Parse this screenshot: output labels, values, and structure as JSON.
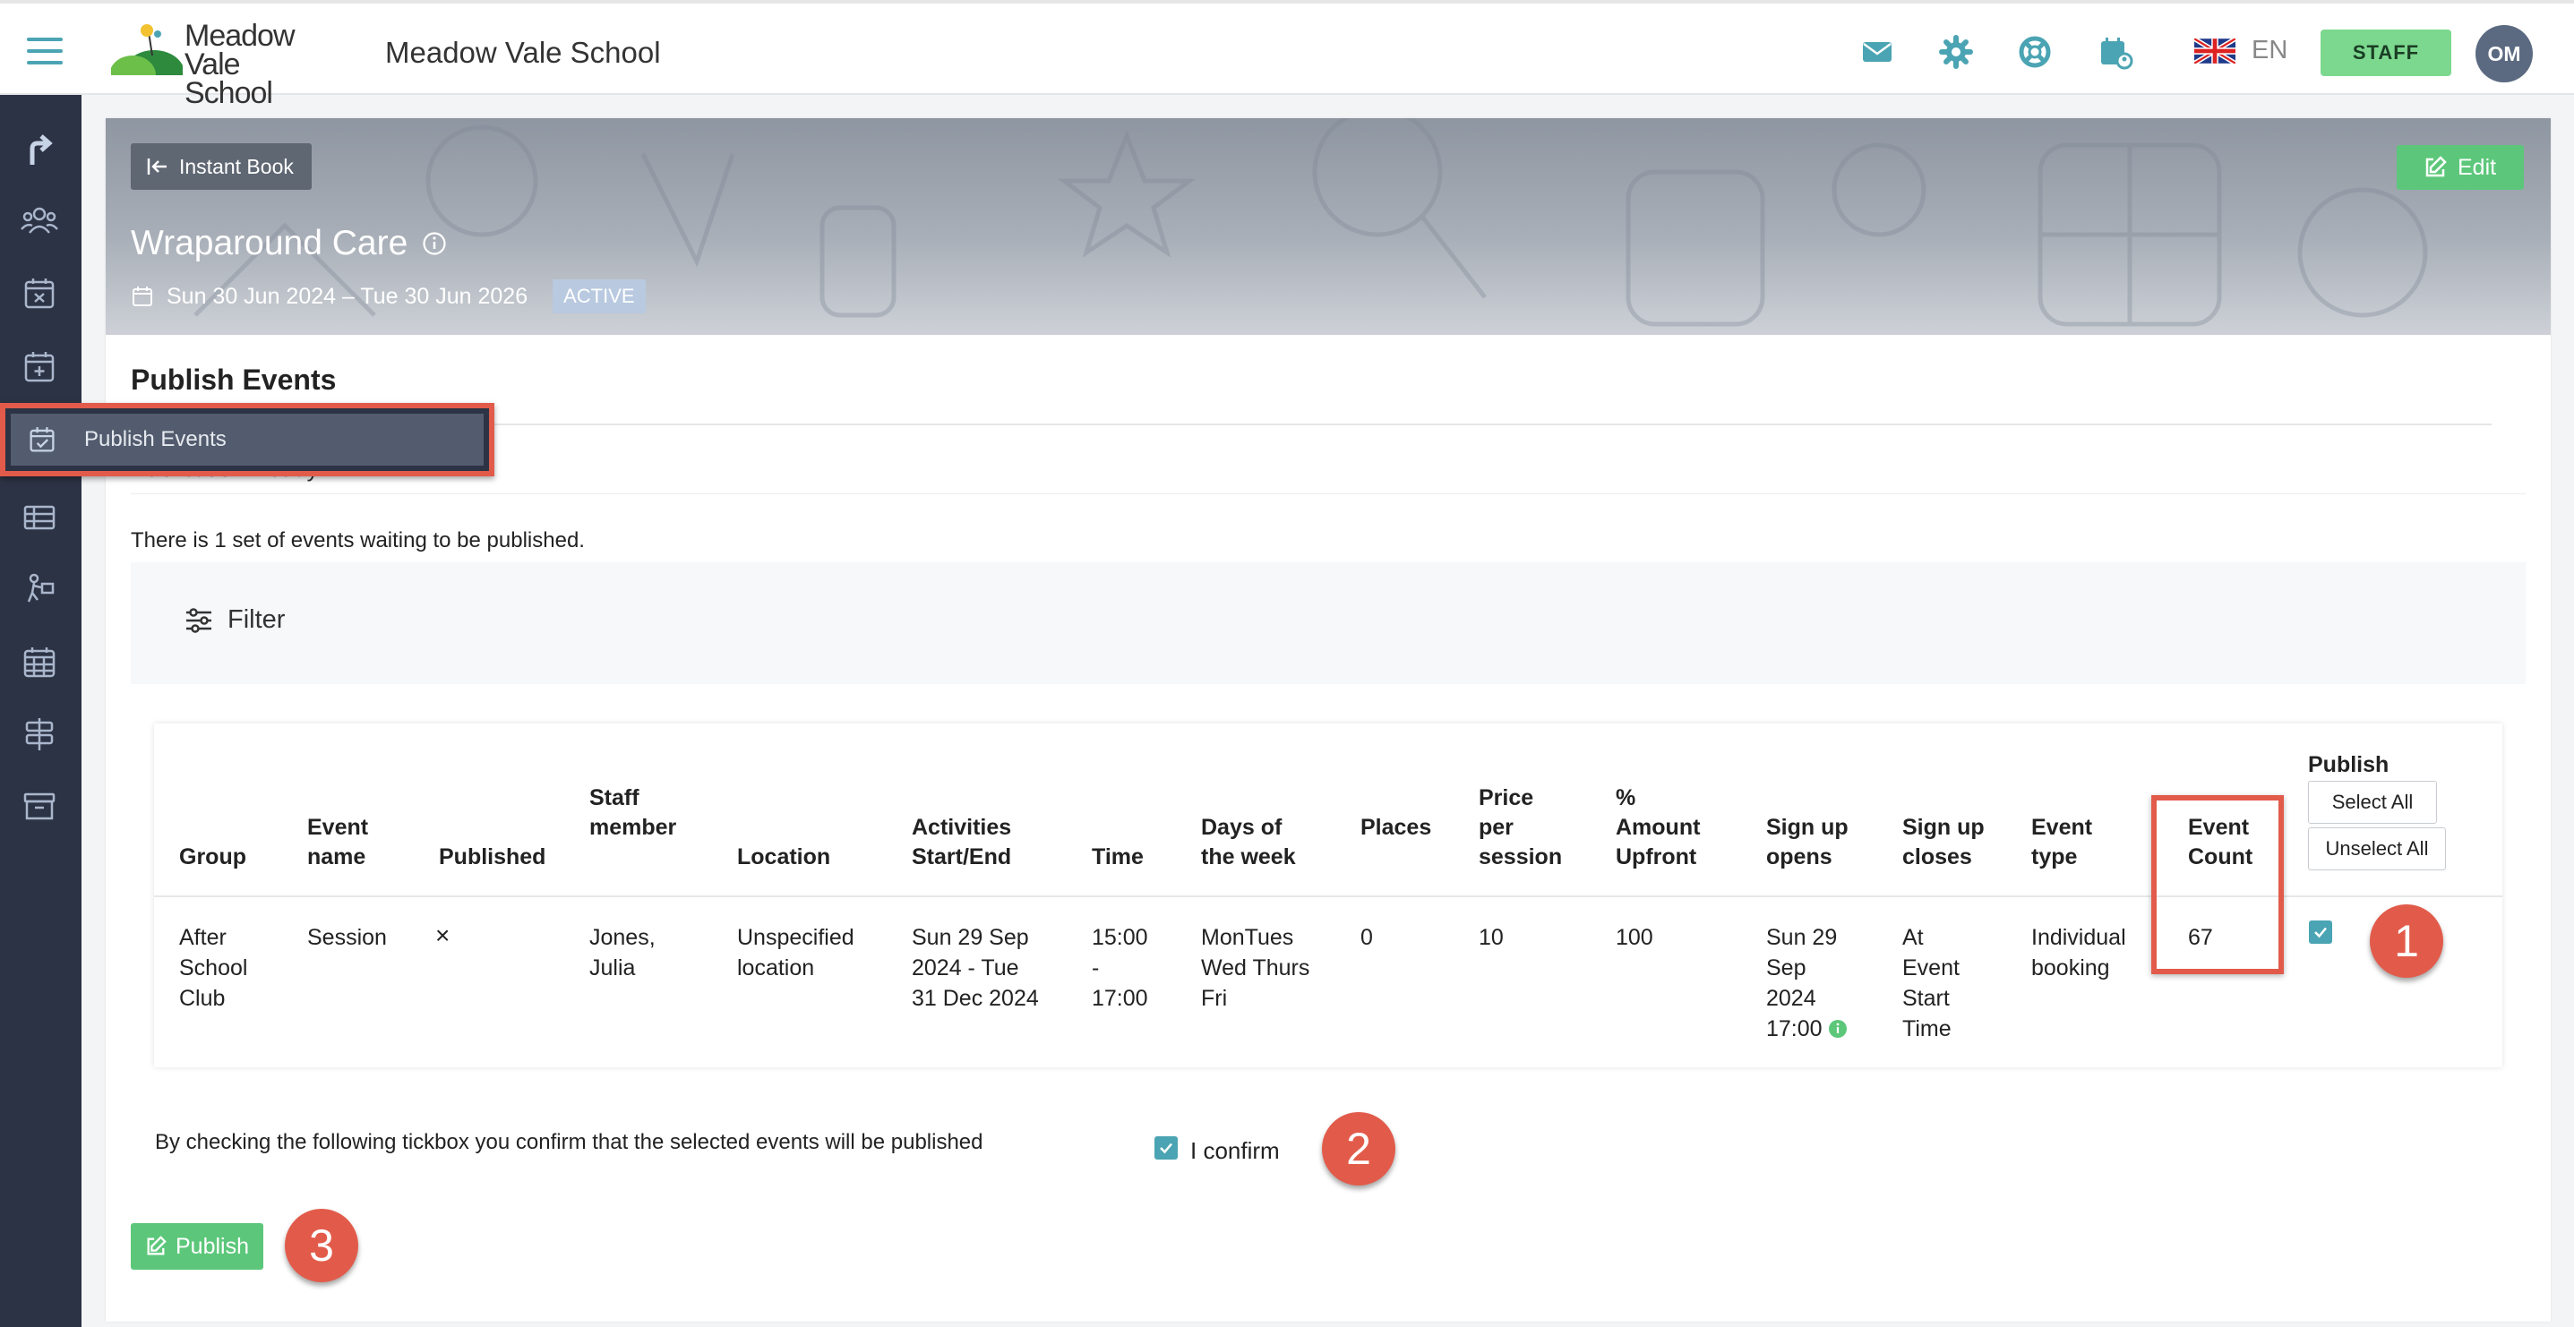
{
  "header": {
    "logo_line1": "Meadow",
    "logo_line2": "Vale School",
    "school_name": "Meadow Vale School",
    "icons": [
      "mail-icon",
      "gear-icon",
      "lifebuoy-icon",
      "calendar-user-icon"
    ],
    "language": "EN",
    "staff_label": "STAFF",
    "avatar_initials": "OM",
    "accent_color": "#4ba4b3"
  },
  "sidebar": {
    "items": [
      "arrow-up-icon",
      "users-icon",
      "calendar-x-icon",
      "calendar-plus-icon",
      "calendar-check-icon",
      "table-icon",
      "person-activity-icon",
      "calendar-grid-icon",
      "signpost-icon",
      "archive-icon"
    ],
    "tooltip_label": "Publish Events"
  },
  "banner": {
    "instant_book_label": "Instant Book",
    "edit_label": "Edit",
    "title": "Wraparound Care",
    "dates": "Sun 30 Jun 2024 – Tue 30 Jun 2026",
    "status": "ACTIVE"
  },
  "publish": {
    "section_title": "Publish Events",
    "subheading": "Publication Ready",
    "waiting_text": "There is 1 set of events waiting to be published.",
    "filter_label": "Filter"
  },
  "table": {
    "headers": {
      "group": "Group",
      "event_name_1": "Event",
      "event_name_2": "name",
      "published": "Published",
      "staff_1": "Staff",
      "staff_2": "member",
      "location": "Location",
      "activities_1": "Activities",
      "activities_2": "Start/End",
      "time": "Time",
      "days_1": "Days of",
      "days_2": "the week",
      "places": "Places",
      "price_1": "Price",
      "price_2": "per",
      "price_3": "session",
      "amount_1": "%",
      "amount_2": "Amount",
      "amount_3": "Upfront",
      "opens_1": "Sign up",
      "opens_2": "opens",
      "closes_1": "Sign up",
      "closes_2": "closes",
      "type_1": "Event",
      "type_2": "type",
      "count_1": "Event",
      "count_2": "Count",
      "publish": "Publish"
    },
    "select_all_label": "Select All",
    "unselect_all_label": "Unselect All",
    "row": {
      "group_1": "After",
      "group_2": "School",
      "group_3": "Club",
      "event_name": "Session",
      "published": "×",
      "staff_1": "Jones,",
      "staff_2": "Julia",
      "location_1": "Unspecified",
      "location_2": "location",
      "activities_1": "Sun 29 Sep",
      "activities_2": "2024 - Tue",
      "activities_3": "31 Dec 2024",
      "time_1": "15:00",
      "time_2": "-",
      "time_3": "17:00",
      "days_1": "MonTues",
      "days_2": "Wed Thurs",
      "days_3": "Fri",
      "places": "0",
      "price": "10",
      "amount": "100",
      "opens_1": "Sun 29",
      "opens_2": "Sep",
      "opens_3": "2024",
      "opens_4": "17:00",
      "closes_1": "At",
      "closes_2": "Event",
      "closes_3": "Start",
      "closes_4": "Time",
      "type_1": "Individual",
      "type_2": "booking",
      "event_count": "67",
      "publish_checked": true
    }
  },
  "confirm": {
    "text": "By checking the following tickbox you confirm that the selected events will be published",
    "label": "I confirm",
    "checked": true
  },
  "actions": {
    "publish_label": "Publish"
  },
  "annotations": {
    "callout_1": "1",
    "callout_2": "2",
    "callout_3": "3",
    "color": "#e25b4a"
  }
}
